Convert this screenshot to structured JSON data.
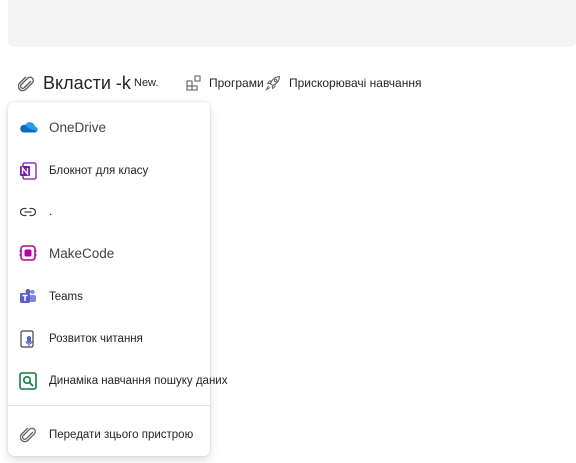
{
  "toolbar": {
    "attach_label": "Вкласти -k",
    "new_badge": "New.",
    "apps_label": "Програми",
    "boosters_label": "Прискорювачі навчання"
  },
  "menu": {
    "items": [
      {
        "label": "OneDrive",
        "icon": "onedrive-icon"
      },
      {
        "label": "Блокнот для класу",
        "icon": "onenote-icon"
      },
      {
        "label": ".",
        "icon": "link-icon"
      },
      {
        "label": "MakeCode",
        "icon": "makecode-icon"
      },
      {
        "label": "Teams",
        "icon": "teams-icon"
      },
      {
        "label": "Розвиток читання",
        "icon": "reading-progress-icon"
      },
      {
        "label": "Динаміка навчання пошуку даних",
        "icon": "search-progress-icon"
      }
    ],
    "upload_label": "Передати зцього пристрою"
  },
  "colors": {
    "onedrive": "#0f6cbd",
    "onenote": "#7719aa",
    "makecode": "#b4009e",
    "teams": "#5b5fc7",
    "search_progress": "#107c41"
  }
}
